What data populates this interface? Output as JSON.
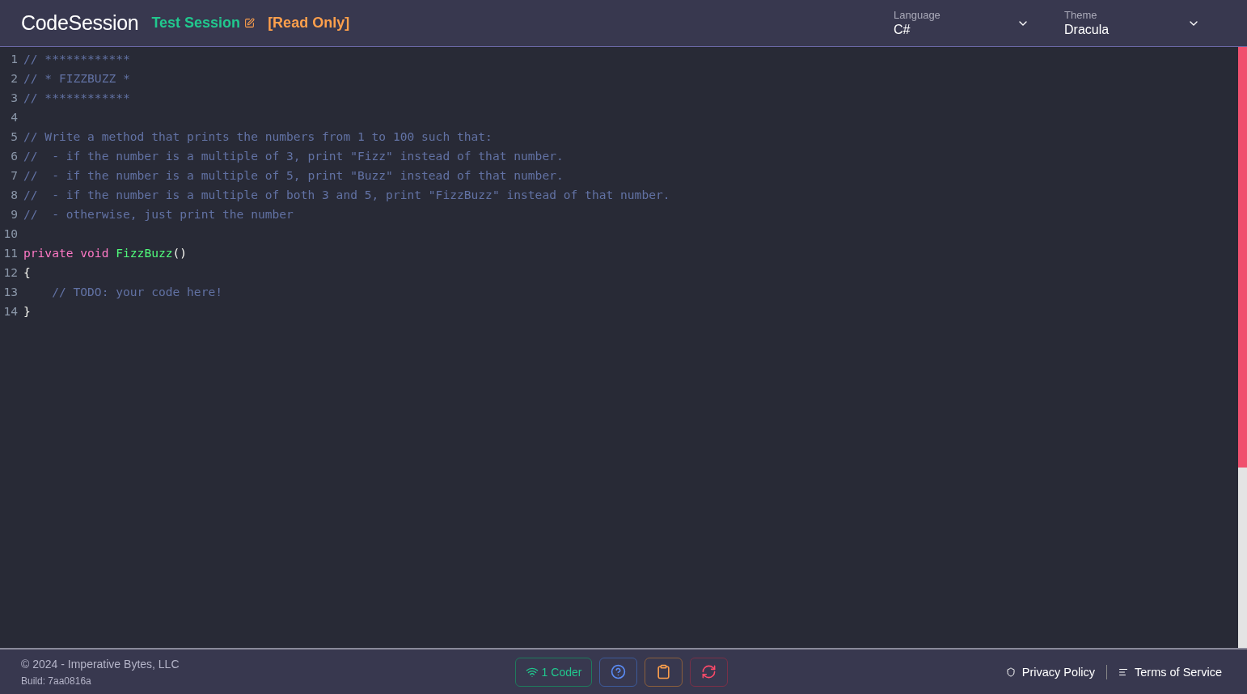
{
  "header": {
    "brand": "CodeSession",
    "session_name": "Test Session",
    "mode": "[Read Only]",
    "selects": [
      {
        "label": "Language",
        "value": "C#"
      },
      {
        "label": "Theme",
        "value": "Dracula"
      }
    ]
  },
  "editor": {
    "lines": [
      {
        "number": "1",
        "tokens": [
          {
            "kind": "comment",
            "text": "// ************"
          }
        ]
      },
      {
        "number": "2",
        "tokens": [
          {
            "kind": "comment",
            "text": "// * FIZZBUZZ *"
          }
        ]
      },
      {
        "number": "3",
        "tokens": [
          {
            "kind": "comment",
            "text": "// ************"
          }
        ]
      },
      {
        "number": "4"
      },
      {
        "number": "5",
        "tokens": [
          {
            "kind": "comment",
            "text": "// Write a method that prints the numbers from 1 to 100 such that:"
          }
        ]
      },
      {
        "number": "6",
        "tokens": [
          {
            "kind": "comment",
            "text": "//  - if the number is a multiple of 3, print \"Fizz\" instead of that number."
          }
        ]
      },
      {
        "number": "7",
        "tokens": [
          {
            "kind": "comment",
            "text": "//  - if the number is a multiple of 5, print \"Buzz\" instead of that number."
          }
        ]
      },
      {
        "number": "8",
        "tokens": [
          {
            "kind": "comment",
            "text": "//  - if the number is a multiple of both 3 and 5, print \"FizzBuzz\" instead of that number."
          }
        ]
      },
      {
        "number": "9",
        "tokens": [
          {
            "kind": "comment",
            "text": "//  - otherwise, just print the number"
          }
        ]
      },
      {
        "number": "10"
      },
      {
        "number": "11",
        "tokens": [
          {
            "kind": "keyword",
            "text": "private"
          },
          {
            "kind": "keyword",
            "text": "void",
            "space_before": true
          },
          {
            "kind": "function",
            "text": "FizzBuzz",
            "space_before": true
          },
          {
            "kind": "plain",
            "text": "()"
          }
        ]
      },
      {
        "number": "12",
        "tokens": [
          {
            "kind": "plain",
            "text": "{"
          }
        ]
      },
      {
        "number": "13",
        "indent": true,
        "tokens": [
          {
            "kind": "comment",
            "text": "// TODO: your code here!"
          }
        ]
      },
      {
        "number": "14",
        "tokens": [
          {
            "kind": "plain",
            "text": "}"
          }
        ]
      }
    ]
  },
  "footer": {
    "copyright": "© 2024 - Imperative Bytes, LLC",
    "build": "Build: 7aa0816a",
    "actions": [
      {
        "kind": "coders",
        "label": "1 Coder"
      },
      {
        "kind": "help"
      },
      {
        "kind": "copy"
      },
      {
        "kind": "sync"
      }
    ],
    "links": [
      {
        "kind": "privacy",
        "label": "Privacy Policy"
      },
      {
        "kind": "terms",
        "label": "Terms of Service"
      }
    ]
  }
}
